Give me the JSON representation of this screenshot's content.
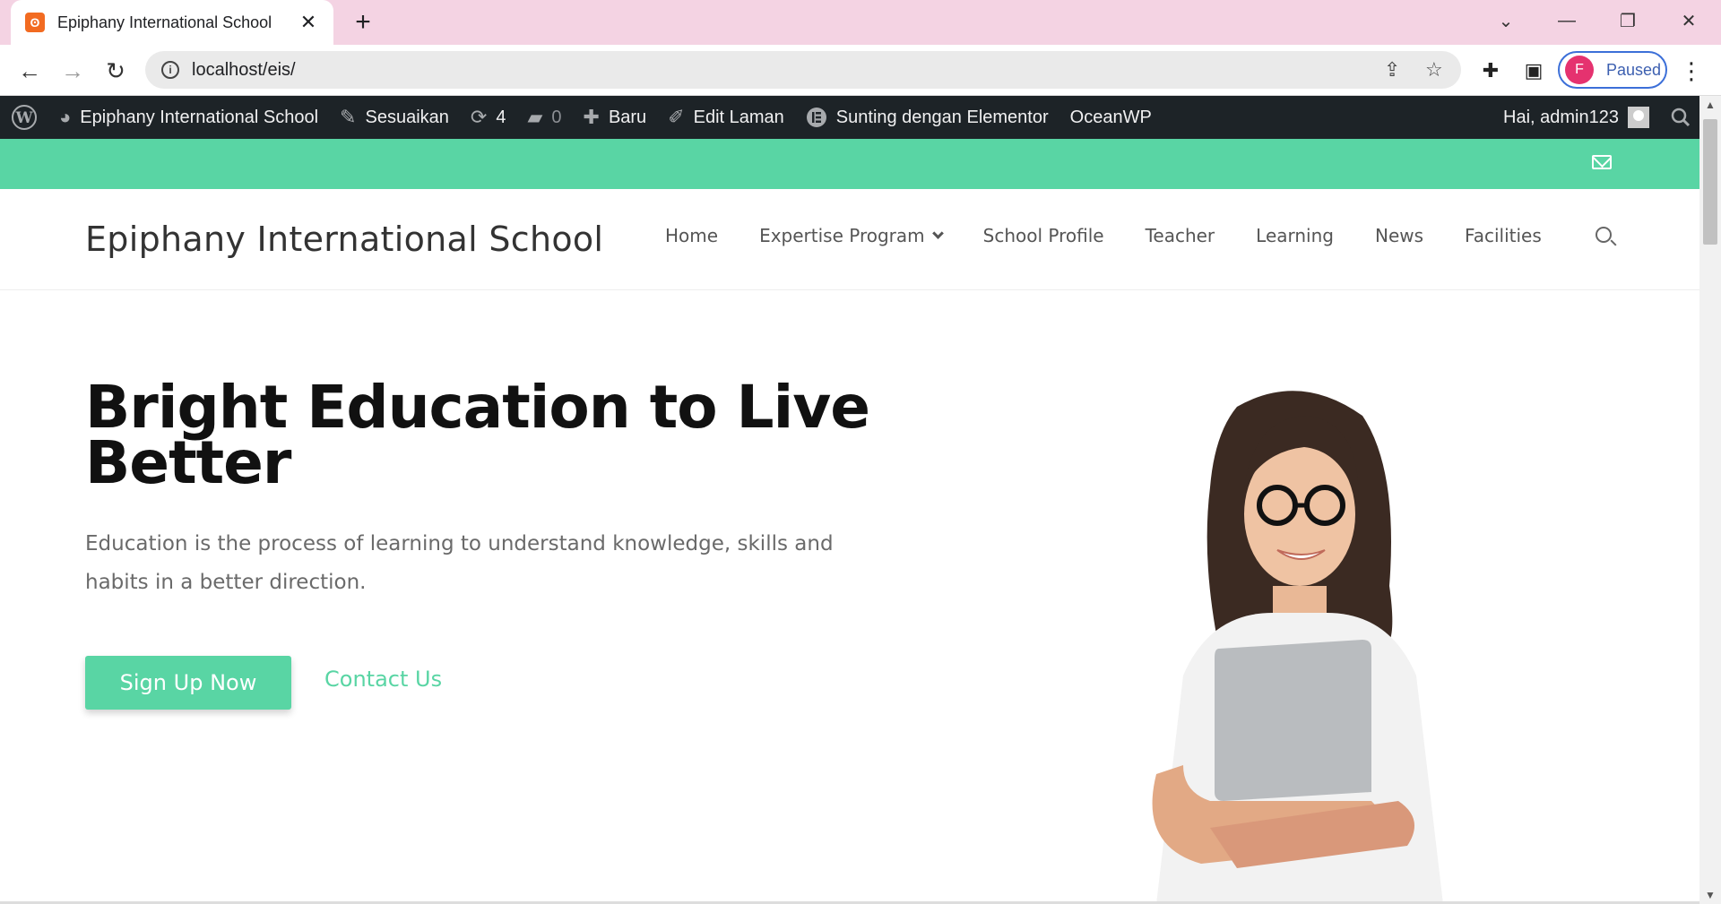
{
  "browser": {
    "tab_title": "Epiphany International School",
    "url": "localhost/eis/",
    "profile_initial": "F",
    "profile_status": "Paused"
  },
  "adminbar": {
    "site_name": "Epiphany International School",
    "customize": "Sesuaikan",
    "updates_count": "4",
    "comments_count": "0",
    "new": "Baru",
    "edit_page": "Edit Laman",
    "elementor": "Sunting dengan Elementor",
    "theme": "OceanWP",
    "greeting": "Hai, admin123"
  },
  "site": {
    "title": "Epiphany International School",
    "nav": [
      {
        "label": "Home"
      },
      {
        "label": "Expertise Program"
      },
      {
        "label": "School Profile"
      },
      {
        "label": "Teacher"
      },
      {
        "label": "Learning"
      },
      {
        "label": "News"
      },
      {
        "label": "Facilities"
      }
    ]
  },
  "hero": {
    "title": "Bright Education to Live Better",
    "text": "Education is the process of learning to understand knowledge, skills and habits in a better direction.",
    "cta_primary": "Sign Up Now",
    "cta_secondary": "Contact Us"
  },
  "colors": {
    "accent": "#59d5a4",
    "adminbar": "#1d2327",
    "tabbar": "#f4d3e3"
  },
  "icons": [
    "wordpress-icon",
    "dashboard-icon",
    "brush-icon",
    "updates-icon",
    "comment-icon",
    "plus-icon",
    "pencil-icon",
    "elementor-icon",
    "mail-icon",
    "search-icon"
  ]
}
